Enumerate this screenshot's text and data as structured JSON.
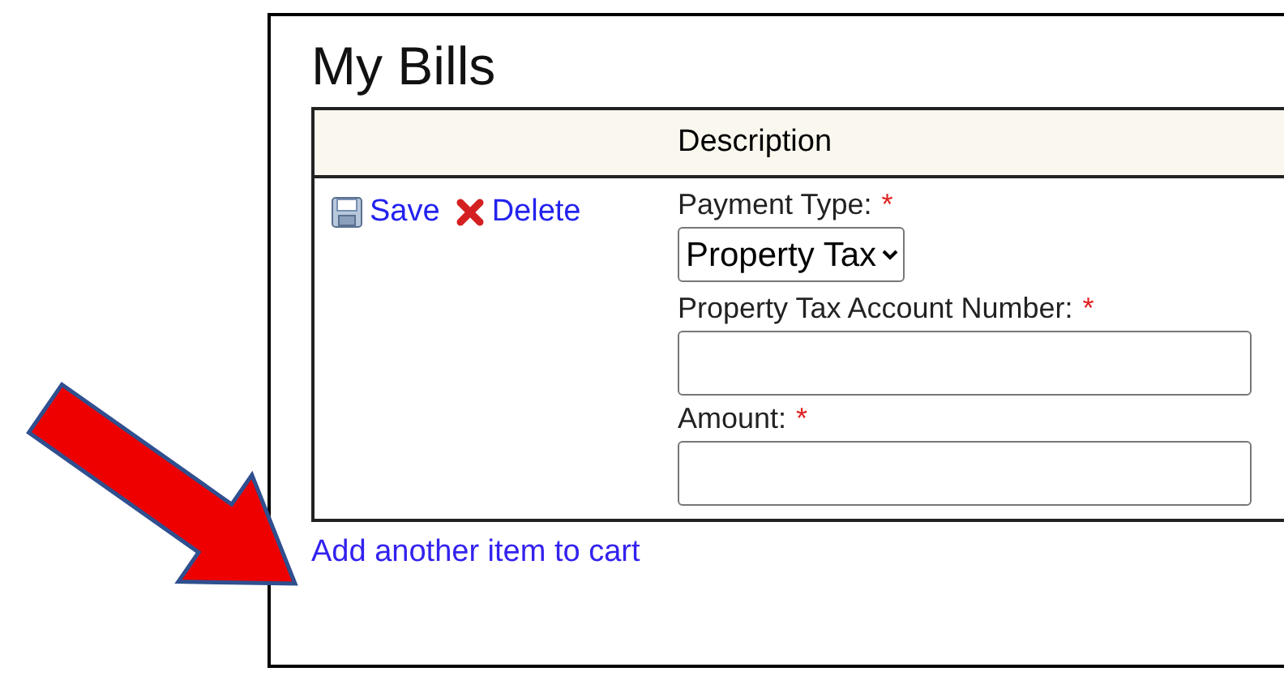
{
  "title": "My Bills",
  "table": {
    "columns": [
      "Description"
    ],
    "row": {
      "actions": [
        {
          "kind": "save",
          "label": "Save"
        },
        {
          "kind": "delete",
          "label": "Delete"
        }
      ],
      "fields": [
        {
          "kind": "select",
          "label": "Payment Type:",
          "required_mark": "*",
          "value": "Property Tax"
        },
        {
          "kind": "text",
          "label": "Property Tax Account Number:",
          "required_mark": "*"
        },
        {
          "kind": "text",
          "label": "Amount:",
          "required_mark": "*"
        }
      ]
    }
  },
  "add_link": "Add another item to cart"
}
